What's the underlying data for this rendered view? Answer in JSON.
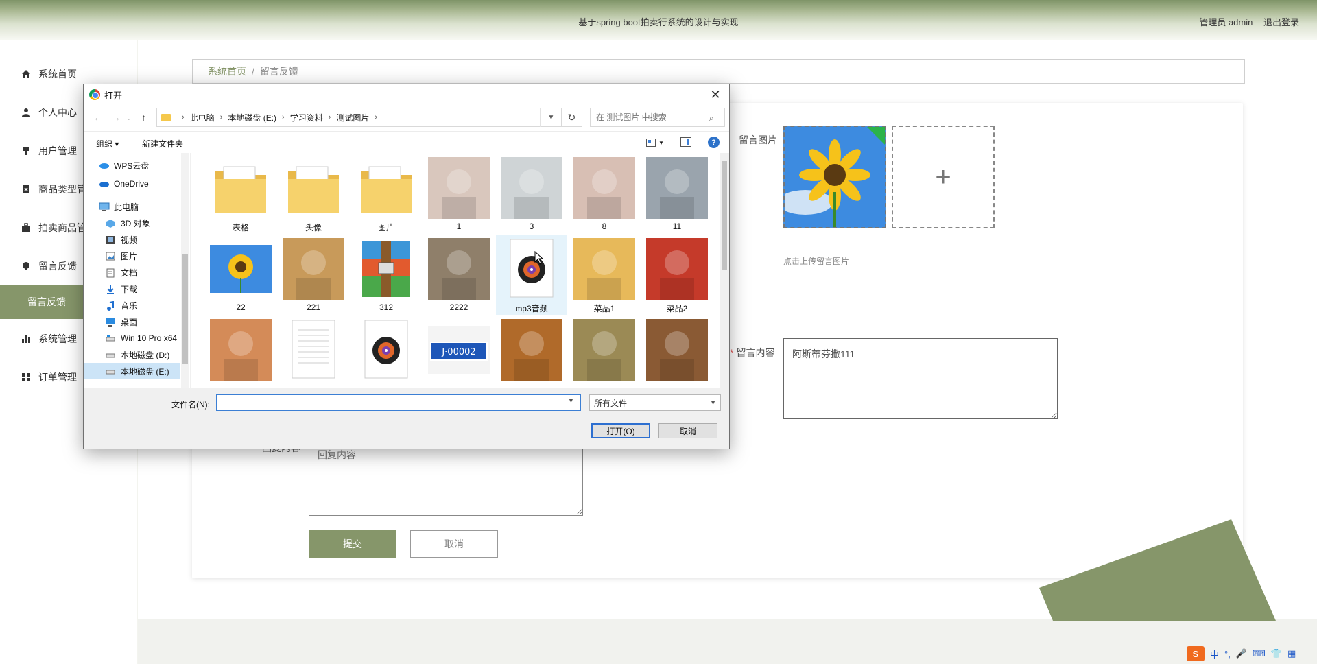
{
  "header": {
    "site_title": "基于spring boot拍卖行系统的设计与实现",
    "admin_label": "管理员 admin",
    "logout_label": "退出登录"
  },
  "sidebar": {
    "items": [
      {
        "label": "系统首页",
        "icon": "home-icon"
      },
      {
        "label": "个人中心",
        "icon": "user-icon"
      },
      {
        "label": "用户管理",
        "icon": "pin-icon"
      },
      {
        "label": "商品类型管理",
        "icon": "clipboard-icon"
      },
      {
        "label": "拍卖商品管理",
        "icon": "briefcase-icon"
      },
      {
        "label": "留言反馈",
        "icon": "bulb-icon"
      },
      {
        "label": "留言反馈",
        "icon": "",
        "active": true
      },
      {
        "label": "系统管理",
        "icon": "bar-chart-icon"
      },
      {
        "label": "订单管理",
        "icon": "grid-icon"
      }
    ]
  },
  "breadcrumb": {
    "home": "系统首页",
    "separator": "/",
    "current": "留言反馈"
  },
  "form": {
    "image_label": "留言图片",
    "upload_hint": "点击上传留言图片",
    "content_label": "留言内容",
    "content_value": "阿斯蒂芬撒111",
    "reply_label": "回复内容",
    "reply_placeholder": "回复内容",
    "submit_label": "提交",
    "cancel_label": "取消"
  },
  "colors": {
    "accent": "#86966a",
    "dialog_focus": "#2d6fd0"
  },
  "ime": {
    "logo": "S",
    "lang": "中",
    "punct": "°,"
  },
  "dialog": {
    "title": "打开",
    "close_glyph": "✕",
    "breadcrumb": [
      "此电脑",
      "本地磁盘 (E:)",
      "学习资料",
      "测试图片"
    ],
    "search_placeholder": "在 测试图片 中搜索",
    "organize_label": "组织 ▾",
    "new_folder_label": "新建文件夹",
    "nav_tree": [
      {
        "label": "WPS云盘",
        "icon": "cloud-icon"
      },
      {
        "label": "OneDrive",
        "icon": "cloud-icon"
      },
      {
        "label": "此电脑",
        "icon": "computer-icon"
      },
      {
        "label": "3D 对象",
        "icon": "cube-icon"
      },
      {
        "label": "视频",
        "icon": "video-icon"
      },
      {
        "label": "图片",
        "icon": "image-icon"
      },
      {
        "label": "文档",
        "icon": "document-icon"
      },
      {
        "label": "下载",
        "icon": "download-icon"
      },
      {
        "label": "音乐",
        "icon": "music-icon"
      },
      {
        "label": "桌面",
        "icon": "desktop-icon"
      },
      {
        "label": "Win 10 Pro x64",
        "icon": "drive-icon"
      },
      {
        "label": "本地磁盘 (D:)",
        "icon": "drive-icon"
      },
      {
        "label": "本地磁盘 (E:)",
        "icon": "drive-icon",
        "selected": true
      }
    ],
    "files": [
      {
        "name": "表格",
        "kind": "folder"
      },
      {
        "name": "头像",
        "kind": "folder"
      },
      {
        "name": "图片",
        "kind": "folder"
      },
      {
        "name": "1",
        "kind": "photo",
        "color": "#d9c7bd"
      },
      {
        "name": "3",
        "kind": "photo",
        "color": "#cfd4d6"
      },
      {
        "name": "8",
        "kind": "photo",
        "color": "#d8bfb4"
      },
      {
        "name": "11",
        "kind": "photo",
        "color": "#9aa4ad"
      },
      {
        "name": "22",
        "kind": "sunflower"
      },
      {
        "name": "221",
        "kind": "photo",
        "color": "#c89a5a"
      },
      {
        "name": "312",
        "kind": "archive"
      },
      {
        "name": "2222",
        "kind": "photo",
        "color": "#8f7f6a"
      },
      {
        "name": "mp3音频",
        "kind": "audio"
      },
      {
        "name": "菜品1",
        "kind": "photo",
        "color": "#e7b95a"
      },
      {
        "name": "菜品2",
        "kind": "photo",
        "color": "#c53a2a"
      },
      {
        "name": "",
        "kind": "photo",
        "color": "#d48b58"
      },
      {
        "name": "",
        "kind": "document"
      },
      {
        "name": "",
        "kind": "audio"
      },
      {
        "name": "",
        "kind": "plate",
        "plate_text": "J·00002"
      },
      {
        "name": "",
        "kind": "photo",
        "color": "#b06a2a"
      },
      {
        "name": "",
        "kind": "photo",
        "color": "#9b8a55"
      },
      {
        "name": "",
        "kind": "photo",
        "color": "#8a5a34"
      }
    ],
    "filename_label": "文件名(N):",
    "filename_value": "",
    "filetype_value": "所有文件",
    "open_label": "打开(O)",
    "cancel_label": "取消"
  }
}
